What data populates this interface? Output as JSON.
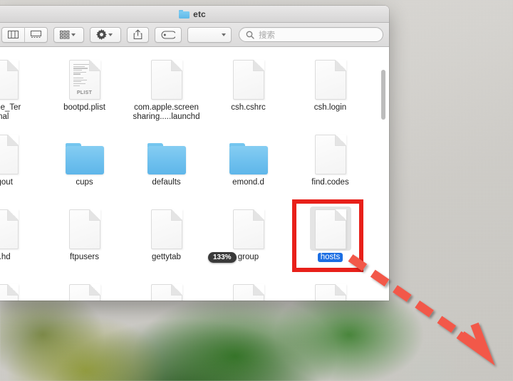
{
  "window": {
    "title": "etc",
    "title_icon": "folder-icon"
  },
  "toolbar": {
    "view_columns_icon": "view-columns-icon",
    "view_coverflow_icon": "view-coverflow-icon",
    "arrange_icon": "arrange-grid-icon",
    "arrange_caret_icon": "chevron-down-icon",
    "action_icon": "gear-icon",
    "action_caret_icon": "chevron-down-icon",
    "share_icon": "share-icon",
    "tag_icon": "tag-icon",
    "extra_caret_icon": "chevron-down-icon",
    "search": {
      "icon": "search-icon",
      "placeholder": "搜索",
      "value": ""
    }
  },
  "files": [
    {
      "name": "Apple_Ter\ninal",
      "type": "document",
      "selected": false,
      "clipped": true
    },
    {
      "name": "bootpd.plist",
      "type": "plist",
      "selected": false
    },
    {
      "name": "com.apple.screen\nsharing.....launchd",
      "type": "document",
      "selected": false
    },
    {
      "name": "csh.cshrc",
      "type": "document",
      "selected": false
    },
    {
      "name": "csh.login",
      "type": "document",
      "selected": false
    },
    {
      "name": "",
      "type": "document",
      "selected": false,
      "offscreen": true
    },
    {
      "name": "ogout",
      "type": "document",
      "selected": false,
      "clipped": true
    },
    {
      "name": "cups",
      "type": "folder",
      "selected": false
    },
    {
      "name": "defaults",
      "type": "folder",
      "selected": false
    },
    {
      "name": "emond.d",
      "type": "folder",
      "selected": false
    },
    {
      "name": "find.codes",
      "type": "document",
      "selected": false
    },
    {
      "name": "",
      "type": "document",
      "selected": false,
      "offscreen": true
    },
    {
      "name": "b.hd",
      "type": "document",
      "selected": false,
      "clipped": true
    },
    {
      "name": "ftpusers",
      "type": "document",
      "selected": false
    },
    {
      "name": "gettytab",
      "type": "document",
      "selected": false
    },
    {
      "name": "group",
      "type": "document",
      "selected": false
    },
    {
      "name": "hosts",
      "type": "document",
      "selected": true
    },
    {
      "name": "",
      "type": "document",
      "selected": false,
      "offscreen": true
    },
    {
      "name": "",
      "type": "document",
      "selected": false,
      "partial": true
    },
    {
      "name": "",
      "type": "document",
      "selected": false,
      "partial": true
    },
    {
      "name": "",
      "type": "document",
      "selected": false,
      "partial": true
    },
    {
      "name": "",
      "type": "document",
      "selected": false,
      "partial": true
    },
    {
      "name": "",
      "type": "document",
      "selected": false,
      "partial": true
    },
    {
      "name": "",
      "type": "document",
      "selected": false,
      "partial": true
    }
  ],
  "plist_badge_text": "PLIST",
  "zoom_badge": {
    "text": "133%"
  },
  "annotations": {
    "highlight_color": "#e8201a",
    "arrow_color": "#f2584a",
    "arrow_style": "dashed-diagonal-arrow"
  },
  "colors": {
    "selection_blue": "#1b6ee3",
    "folder_blue": "#6ec0ee",
    "titlebar_gray": "#e1e0e0"
  }
}
